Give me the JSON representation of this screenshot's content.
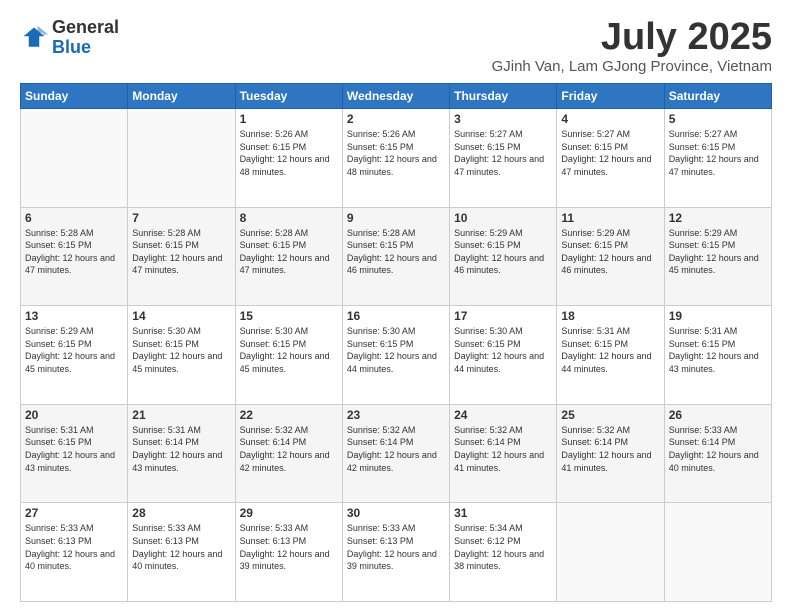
{
  "header": {
    "logo": {
      "general": "General",
      "blue": "Blue"
    },
    "title": "July 2025",
    "location": "GJinh Van, Lam GJong Province, Vietnam"
  },
  "weekdays": [
    "Sunday",
    "Monday",
    "Tuesday",
    "Wednesday",
    "Thursday",
    "Friday",
    "Saturday"
  ],
  "weeks": [
    [
      {
        "day": "",
        "info": ""
      },
      {
        "day": "",
        "info": ""
      },
      {
        "day": "1",
        "info": "Sunrise: 5:26 AM\nSunset: 6:15 PM\nDaylight: 12 hours and 48 minutes."
      },
      {
        "day": "2",
        "info": "Sunrise: 5:26 AM\nSunset: 6:15 PM\nDaylight: 12 hours and 48 minutes."
      },
      {
        "day": "3",
        "info": "Sunrise: 5:27 AM\nSunset: 6:15 PM\nDaylight: 12 hours and 47 minutes."
      },
      {
        "day": "4",
        "info": "Sunrise: 5:27 AM\nSunset: 6:15 PM\nDaylight: 12 hours and 47 minutes."
      },
      {
        "day": "5",
        "info": "Sunrise: 5:27 AM\nSunset: 6:15 PM\nDaylight: 12 hours and 47 minutes."
      }
    ],
    [
      {
        "day": "6",
        "info": "Sunrise: 5:28 AM\nSunset: 6:15 PM\nDaylight: 12 hours and 47 minutes."
      },
      {
        "day": "7",
        "info": "Sunrise: 5:28 AM\nSunset: 6:15 PM\nDaylight: 12 hours and 47 minutes."
      },
      {
        "day": "8",
        "info": "Sunrise: 5:28 AM\nSunset: 6:15 PM\nDaylight: 12 hours and 47 minutes."
      },
      {
        "day": "9",
        "info": "Sunrise: 5:28 AM\nSunset: 6:15 PM\nDaylight: 12 hours and 46 minutes."
      },
      {
        "day": "10",
        "info": "Sunrise: 5:29 AM\nSunset: 6:15 PM\nDaylight: 12 hours and 46 minutes."
      },
      {
        "day": "11",
        "info": "Sunrise: 5:29 AM\nSunset: 6:15 PM\nDaylight: 12 hours and 46 minutes."
      },
      {
        "day": "12",
        "info": "Sunrise: 5:29 AM\nSunset: 6:15 PM\nDaylight: 12 hours and 45 minutes."
      }
    ],
    [
      {
        "day": "13",
        "info": "Sunrise: 5:29 AM\nSunset: 6:15 PM\nDaylight: 12 hours and 45 minutes."
      },
      {
        "day": "14",
        "info": "Sunrise: 5:30 AM\nSunset: 6:15 PM\nDaylight: 12 hours and 45 minutes."
      },
      {
        "day": "15",
        "info": "Sunrise: 5:30 AM\nSunset: 6:15 PM\nDaylight: 12 hours and 45 minutes."
      },
      {
        "day": "16",
        "info": "Sunrise: 5:30 AM\nSunset: 6:15 PM\nDaylight: 12 hours and 44 minutes."
      },
      {
        "day": "17",
        "info": "Sunrise: 5:30 AM\nSunset: 6:15 PM\nDaylight: 12 hours and 44 minutes."
      },
      {
        "day": "18",
        "info": "Sunrise: 5:31 AM\nSunset: 6:15 PM\nDaylight: 12 hours and 44 minutes."
      },
      {
        "day": "19",
        "info": "Sunrise: 5:31 AM\nSunset: 6:15 PM\nDaylight: 12 hours and 43 minutes."
      }
    ],
    [
      {
        "day": "20",
        "info": "Sunrise: 5:31 AM\nSunset: 6:15 PM\nDaylight: 12 hours and 43 minutes."
      },
      {
        "day": "21",
        "info": "Sunrise: 5:31 AM\nSunset: 6:14 PM\nDaylight: 12 hours and 43 minutes."
      },
      {
        "day": "22",
        "info": "Sunrise: 5:32 AM\nSunset: 6:14 PM\nDaylight: 12 hours and 42 minutes."
      },
      {
        "day": "23",
        "info": "Sunrise: 5:32 AM\nSunset: 6:14 PM\nDaylight: 12 hours and 42 minutes."
      },
      {
        "day": "24",
        "info": "Sunrise: 5:32 AM\nSunset: 6:14 PM\nDaylight: 12 hours and 41 minutes."
      },
      {
        "day": "25",
        "info": "Sunrise: 5:32 AM\nSunset: 6:14 PM\nDaylight: 12 hours and 41 minutes."
      },
      {
        "day": "26",
        "info": "Sunrise: 5:33 AM\nSunset: 6:14 PM\nDaylight: 12 hours and 40 minutes."
      }
    ],
    [
      {
        "day": "27",
        "info": "Sunrise: 5:33 AM\nSunset: 6:13 PM\nDaylight: 12 hours and 40 minutes."
      },
      {
        "day": "28",
        "info": "Sunrise: 5:33 AM\nSunset: 6:13 PM\nDaylight: 12 hours and 40 minutes."
      },
      {
        "day": "29",
        "info": "Sunrise: 5:33 AM\nSunset: 6:13 PM\nDaylight: 12 hours and 39 minutes."
      },
      {
        "day": "30",
        "info": "Sunrise: 5:33 AM\nSunset: 6:13 PM\nDaylight: 12 hours and 39 minutes."
      },
      {
        "day": "31",
        "info": "Sunrise: 5:34 AM\nSunset: 6:12 PM\nDaylight: 12 hours and 38 minutes."
      },
      {
        "day": "",
        "info": ""
      },
      {
        "day": "",
        "info": ""
      }
    ]
  ]
}
